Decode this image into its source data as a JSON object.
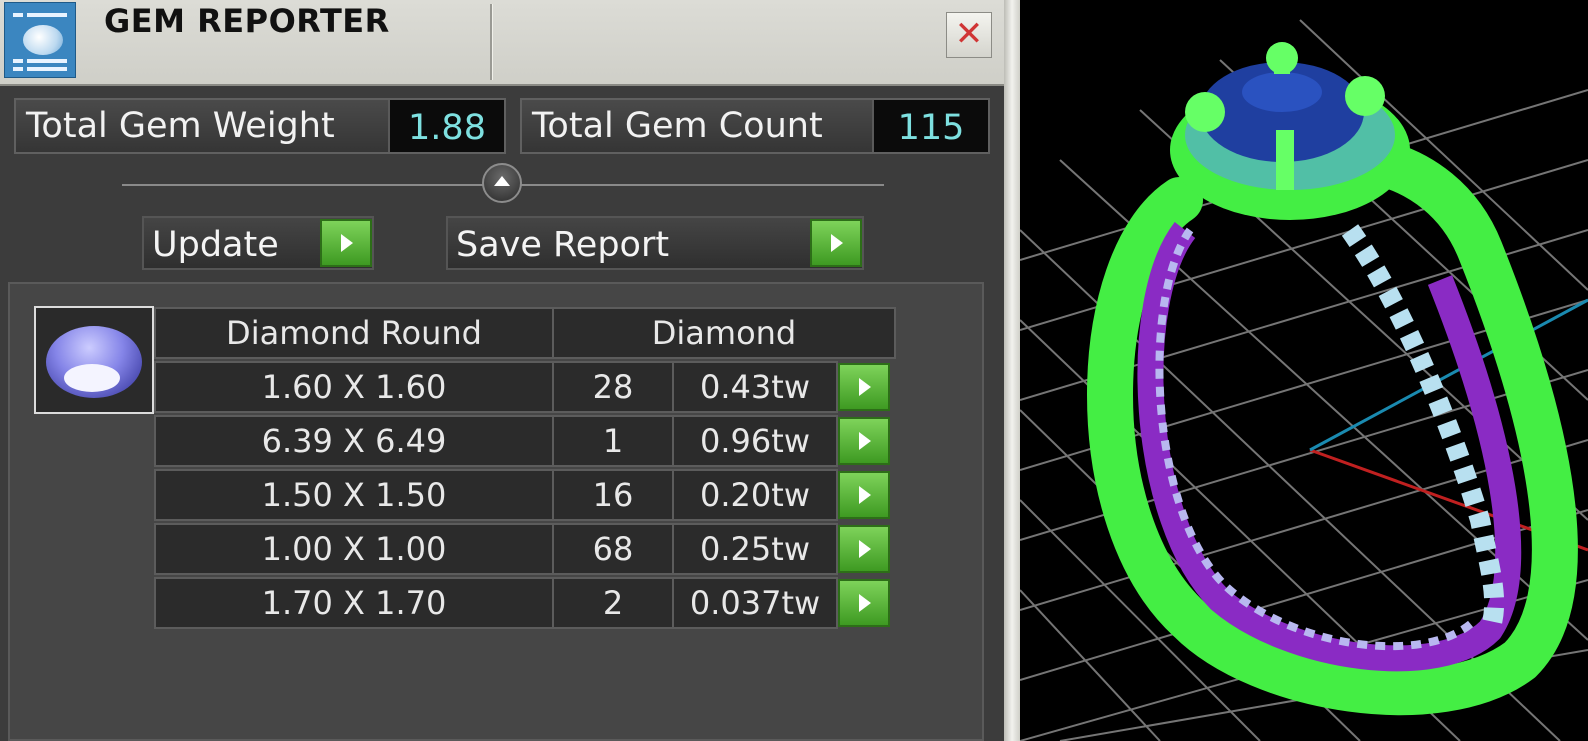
{
  "window": {
    "title": "GEM REPORTER",
    "close_label": "✕"
  },
  "stats": {
    "weight_label": "Total Gem Weight",
    "weight_value": "1.88",
    "count_label": "Total Gem Count",
    "count_value": "115"
  },
  "actions": {
    "update_label": "Update",
    "save_label": "Save Report"
  },
  "gem_table": {
    "shape": "Diamond Round",
    "material": "Diamond",
    "rows": [
      {
        "size": "1.60 X 1.60",
        "count": "28",
        "weight": "0.43tw"
      },
      {
        "size": "6.39 X 6.49",
        "count": "1",
        "weight": "0.96tw"
      },
      {
        "size": "1.50 X 1.50",
        "count": "16",
        "weight": "0.20tw"
      },
      {
        "size": "1.00 X 1.00",
        "count": "68",
        "weight": "0.25tw"
      },
      {
        "size": "1.70 X 1.70",
        "count": "2",
        "weight": "0.037tw"
      }
    ]
  },
  "colors": {
    "accent_green": "#4caf2a",
    "value_cyan": "#7ee0e0",
    "ring_green": "#44ee44",
    "ring_purple": "#8a2bc4",
    "stone_blue": "#1f3fa0"
  },
  "icons": [
    "gem-reporter-app-icon",
    "close-icon",
    "collapse-arrow-icon",
    "play-arrow-icon",
    "diamond-round-icon"
  ]
}
